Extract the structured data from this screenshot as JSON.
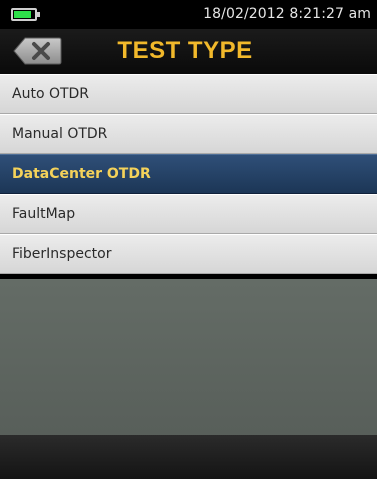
{
  "status_bar": {
    "battery_icon": "battery-icon",
    "battery_level": 0.85,
    "datetime": "18/02/2012 8:21:27 am"
  },
  "header": {
    "back_icon": "close-icon",
    "title": "TEST TYPE"
  },
  "menu": {
    "items": [
      {
        "label": "Auto OTDR",
        "selected": false
      },
      {
        "label": "Manual OTDR",
        "selected": false
      },
      {
        "label": "DataCenter OTDR",
        "selected": true
      },
      {
        "label": "FaultMap",
        "selected": false
      },
      {
        "label": "FiberInspector",
        "selected": false
      }
    ]
  },
  "colors": {
    "title": "#f2b92b",
    "selected_background": "#1c3656",
    "selected_text": "#f4d25a",
    "battery": "#2ee04a"
  }
}
